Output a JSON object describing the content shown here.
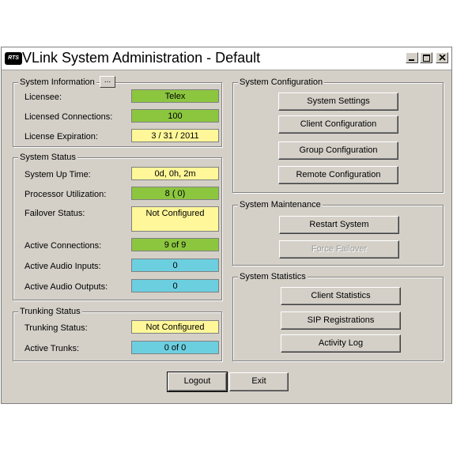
{
  "window": {
    "title": "VLink System Administration - Default",
    "logo_text": "RTS"
  },
  "system_information": {
    "legend": "System Information",
    "more_button": "...",
    "licensee_label": "Licensee:",
    "licensee_value": "Telex",
    "licensed_connections_label": "Licensed Connections:",
    "licensed_connections_value": "100",
    "license_expiration_label": "License Expiration:",
    "license_expiration_value": "3 / 31 / 2011"
  },
  "system_status": {
    "legend": "System Status",
    "uptime_label": "System Up Time:",
    "uptime_value": "0d,  0h,  2m",
    "processor_label": "Processor Utilization:",
    "processor_value": "8 ( 0)",
    "failover_label": "Failover Status:",
    "failover_value": "Not Configured",
    "active_connections_label": "Active Connections:",
    "active_connections_value": "9 of 9",
    "audio_inputs_label": "Active Audio Inputs:",
    "audio_inputs_value": "0",
    "audio_outputs_label": "Active Audio Outputs:",
    "audio_outputs_value": "0"
  },
  "trunking_status": {
    "legend": "Trunking Status",
    "trunking_label": "Trunking Status:",
    "trunking_value": "Not Configured",
    "active_trunks_label": "Active Trunks:",
    "active_trunks_value": "0 of 0"
  },
  "system_configuration": {
    "legend": "System Configuration",
    "buttons": [
      "System Settings",
      "Client Configuration",
      "Group Configuration",
      "Remote Configuration"
    ]
  },
  "system_maintenance": {
    "legend": "System Maintenance",
    "buttons": [
      "Restart System",
      "Force Failover"
    ]
  },
  "system_statistics": {
    "legend": "System Statistics",
    "buttons": [
      "Client Statistics",
      "SIP Registrations",
      "Activity Log"
    ]
  },
  "footer": {
    "logout": "Logout",
    "exit": "Exit"
  },
  "colors": {
    "ok_green": "#8cc63f",
    "info_yellow": "#fff799",
    "count_cyan": "#6ccfe0"
  }
}
